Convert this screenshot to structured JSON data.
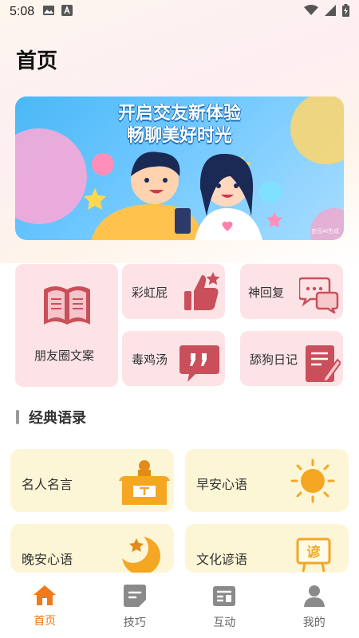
{
  "status": {
    "time": "5:08"
  },
  "page": {
    "title": "首页"
  },
  "banner": {
    "line1": "开启交友新体验",
    "line2": "畅聊美好时光",
    "watermark": "由豆AI生成"
  },
  "categories": [
    {
      "label": "朋友圈文案",
      "icon": "book-icon"
    },
    {
      "label": "彩虹屁",
      "icon": "thumbs-up-star-icon"
    },
    {
      "label": "神回复",
      "icon": "chat-bubbles-icon"
    },
    {
      "label": "毒鸡汤",
      "icon": "quote-bubble-icon"
    },
    {
      "label": "舔狗日记",
      "icon": "note-pen-icon"
    }
  ],
  "section": {
    "title": "经典语录"
  },
  "quotes": [
    {
      "label": "名人名言",
      "icon": "podium-icon"
    },
    {
      "label": "早安心语",
      "icon": "sun-icon"
    },
    {
      "label": "晚安心语",
      "icon": "moon-star-icon"
    },
    {
      "label": "文化谚语",
      "icon": "proverb-sign-icon"
    }
  ],
  "tabs": [
    {
      "label": "首页",
      "icon": "home-icon",
      "active": true
    },
    {
      "label": "技巧",
      "icon": "tips-icon",
      "active": false
    },
    {
      "label": "互动",
      "icon": "interact-icon",
      "active": false
    },
    {
      "label": "我的",
      "icon": "profile-icon",
      "active": false
    }
  ],
  "colors": {
    "accent": "#f07a1a",
    "card_pink": "#fde3e6",
    "card_yellow": "#fdf6d6",
    "icon_red": "#c9505a",
    "icon_orange": "#f5a623"
  }
}
